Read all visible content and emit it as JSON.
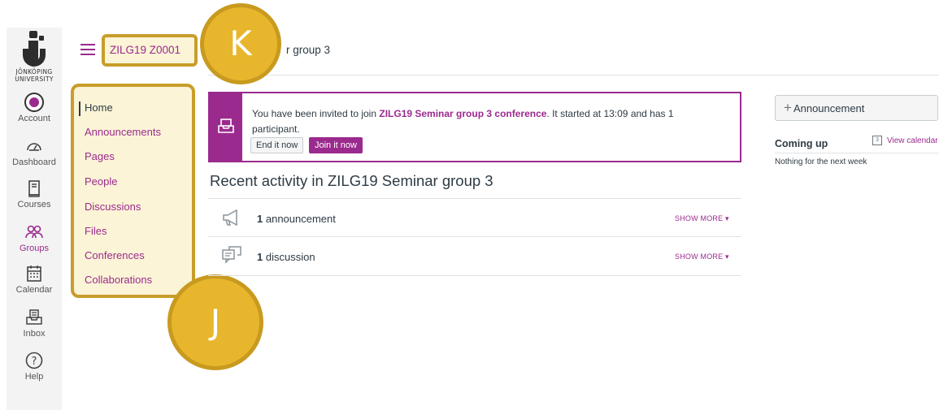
{
  "global_nav": {
    "logo_line1": "JÖNKÖPING",
    "logo_line2": "UNIVERSITY",
    "items": [
      {
        "label": "Account",
        "icon": "account-avatar-icon"
      },
      {
        "label": "Dashboard",
        "icon": "dashboard-gauge-icon"
      },
      {
        "label": "Courses",
        "icon": "book-icon"
      },
      {
        "label": "Groups",
        "icon": "groups-people-icon",
        "active": true
      },
      {
        "label": "Calendar",
        "icon": "calendar-icon"
      },
      {
        "label": "Inbox",
        "icon": "inbox-tray-icon"
      },
      {
        "label": "Help",
        "icon": "help-question-icon"
      }
    ]
  },
  "header": {
    "breadcrumb_course": "ZILG19 Z0001",
    "breadcrumb_group_visible": "r group 3"
  },
  "callouts": {
    "k": "K",
    "j": "J"
  },
  "course_nav": {
    "items": [
      "Home",
      "Announcements",
      "Pages",
      "People",
      "Discussions",
      "Files",
      "Conferences",
      "Collaborations"
    ]
  },
  "conference": {
    "text_before": "You have been invited to join ",
    "conference_name": "ZILG19 Seminar group 3 conference",
    "text_after": ". It started at 13:09 and has 1 participant.",
    "end_label": "End it now",
    "join_label": "Join it now"
  },
  "recent_activity": {
    "title": "Recent activity in ZILG19 Seminar group 3",
    "rows": [
      {
        "count": "1",
        "label": "announcement",
        "more": "SHOW MORE"
      },
      {
        "count": "1",
        "label": "discussion",
        "more": "SHOW MORE"
      }
    ]
  },
  "sidebar": {
    "announcement_button": "Announcement",
    "coming_up": "Coming up",
    "view_calendar": "View calendar",
    "nothing": "Nothing for the next week"
  },
  "colors": {
    "brand": "#9b2a8e",
    "highlight_fill": "#fbf4d6",
    "highlight_border": "#c89d2a",
    "callout": "#e8b62c"
  }
}
